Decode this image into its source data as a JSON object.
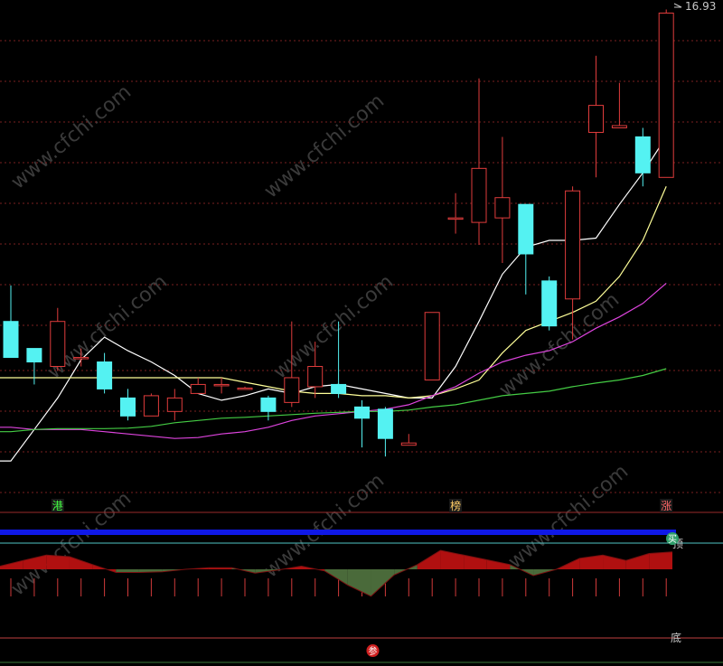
{
  "chart_data": [
    {
      "type": "candlestick",
      "title": "",
      "price_label": "16.93",
      "ylim": [
        6.2,
        17.0
      ],
      "grid": true,
      "colors": {
        "up": "#e03c3c",
        "down": "#54f2f2",
        "ma5": "#ffffff",
        "ma10": "#ffff99",
        "ma20": "#dd44dd",
        "ma60": "#44cc44"
      },
      "candles": [
        {
          "o": 10.0,
          "h": 10.8,
          "l": 9.2,
          "c": 9.2
        },
        {
          "o": 9.4,
          "h": 9.4,
          "l": 8.6,
          "c": 9.1
        },
        {
          "o": 9.0,
          "h": 10.3,
          "l": 8.9,
          "c": 10.0
        },
        {
          "o": 9.2,
          "h": 9.4,
          "l": 9.0,
          "c": 9.2
        },
        {
          "o": 9.1,
          "h": 9.3,
          "l": 8.4,
          "c": 8.5
        },
        {
          "o": 8.3,
          "h": 8.5,
          "l": 7.8,
          "c": 7.9
        },
        {
          "o": 7.9,
          "h": 8.4,
          "l": 7.9,
          "c": 8.35
        },
        {
          "o": 8.0,
          "h": 8.5,
          "l": 7.8,
          "c": 8.3
        },
        {
          "o": 8.4,
          "h": 8.75,
          "l": 8.4,
          "c": 8.6
        },
        {
          "o": 8.6,
          "h": 8.75,
          "l": 8.4,
          "c": 8.6
        },
        {
          "o": 8.5,
          "h": 8.55,
          "l": 8.5,
          "c": 8.52
        },
        {
          "o": 8.3,
          "h": 8.35,
          "l": 7.8,
          "c": 8.0
        },
        {
          "o": 8.2,
          "h": 10.0,
          "l": 8.1,
          "c": 8.75
        },
        {
          "o": 8.55,
          "h": 9.55,
          "l": 8.3,
          "c": 9.0
        },
        {
          "o": 8.6,
          "h": 10.0,
          "l": 8.3,
          "c": 8.4
        },
        {
          "o": 8.1,
          "h": 8.25,
          "l": 7.2,
          "c": 7.85
        },
        {
          "o": 8.05,
          "h": 8.1,
          "l": 7.0,
          "c": 7.4
        },
        {
          "o": 7.25,
          "h": 7.5,
          "l": 7.25,
          "c": 7.3
        },
        {
          "o": 8.7,
          "h": 10.2,
          "l": 8.7,
          "c": 10.2
        },
        {
          "o": 12.3,
          "h": 12.85,
          "l": 11.95,
          "c": 12.3
        },
        {
          "o": 12.2,
          "h": 15.4,
          "l": 11.7,
          "c": 13.4
        },
        {
          "o": 12.3,
          "h": 14.1,
          "l": 11.3,
          "c": 12.75
        },
        {
          "o": 12.6,
          "h": 12.6,
          "l": 10.6,
          "c": 11.5
        },
        {
          "o": 10.9,
          "h": 11.0,
          "l": 9.8,
          "c": 9.9
        },
        {
          "o": 10.5,
          "h": 13.0,
          "l": 9.6,
          "c": 12.9
        },
        {
          "o": 14.2,
          "h": 15.9,
          "l": 13.2,
          "c": 14.8
        },
        {
          "o": 14.3,
          "h": 15.3,
          "l": 14.3,
          "c": 14.35
        },
        {
          "o": 14.1,
          "h": 14.3,
          "l": 13.0,
          "c": 13.3
        },
        {
          "o": 13.2,
          "h": 16.93,
          "l": 13.2,
          "c": 16.85
        }
      ],
      "ma_lines": [
        {
          "name": "ma5",
          "values": [
            6.9,
            7.6,
            8.3,
            9.15,
            9.65,
            9.35,
            9.1,
            8.8,
            8.4,
            8.25,
            8.35,
            8.5,
            8.4,
            8.55,
            8.6,
            8.5,
            8.4,
            8.3,
            8.3,
            9.0,
            10.0,
            11.05,
            11.65,
            11.8,
            11.8,
            11.85,
            12.6,
            13.3,
            14.1
          ]
        },
        {
          "name": "ma10",
          "values": [
            null,
            null,
            null,
            null,
            null,
            null,
            null,
            null,
            null,
            8.75,
            8.65,
            8.55,
            8.45,
            8.4,
            8.4,
            8.35,
            8.35,
            8.3,
            8.35,
            8.5,
            8.7,
            9.3,
            9.8,
            10.0,
            10.2,
            10.45,
            11.0,
            11.8,
            13.0
          ]
        },
        {
          "name": "ma20",
          "values": [
            7.65,
            7.6,
            7.6,
            7.6,
            7.55,
            7.5,
            7.45,
            7.4,
            7.42,
            7.5,
            7.55,
            7.65,
            7.8,
            7.9,
            7.95,
            8.0,
            8.05,
            8.15,
            8.35,
            8.55,
            8.85,
            9.1,
            9.25,
            9.35,
            9.55,
            9.85,
            10.1,
            10.4,
            10.85
          ]
        },
        {
          "name": "ma60",
          "values": [
            7.55,
            7.6,
            7.62,
            7.62,
            7.62,
            7.63,
            7.67,
            7.75,
            7.8,
            7.85,
            7.87,
            7.9,
            7.93,
            7.96,
            7.98,
            8.0,
            8.0,
            8.03,
            8.1,
            8.15,
            8.25,
            8.35,
            8.4,
            8.45,
            8.55,
            8.63,
            8.7,
            8.8,
            8.95
          ]
        }
      ],
      "markers": [
        {
          "index": 2,
          "text": "港",
          "color": "#44ff44"
        },
        {
          "index": 19,
          "text": "榜",
          "color": "#ffcc66"
        },
        {
          "index": 28,
          "text": "涨",
          "color": "#ff6666"
        }
      ]
    },
    {
      "type": "area",
      "title": "",
      "ylim": [
        -1.0,
        1.0
      ],
      "colors": {
        "pos": "#b01010",
        "neg": "#4a6a3a"
      },
      "values": [
        0.1,
        0.28,
        0.45,
        0.4,
        0.15,
        -0.1,
        -0.1,
        -0.08,
        0.0,
        0.05,
        0.05,
        -0.12,
        -0.02,
        0.1,
        -0.05,
        -0.5,
        -0.85,
        -0.18,
        0.15,
        0.6,
        0.45,
        0.3,
        0.15,
        -0.2,
        0.0,
        0.35,
        0.45,
        0.28,
        0.5,
        0.55
      ],
      "labels": {
        "top": "顶",
        "bottom": "底",
        "buy": "买",
        "participate": "参"
      }
    }
  ]
}
